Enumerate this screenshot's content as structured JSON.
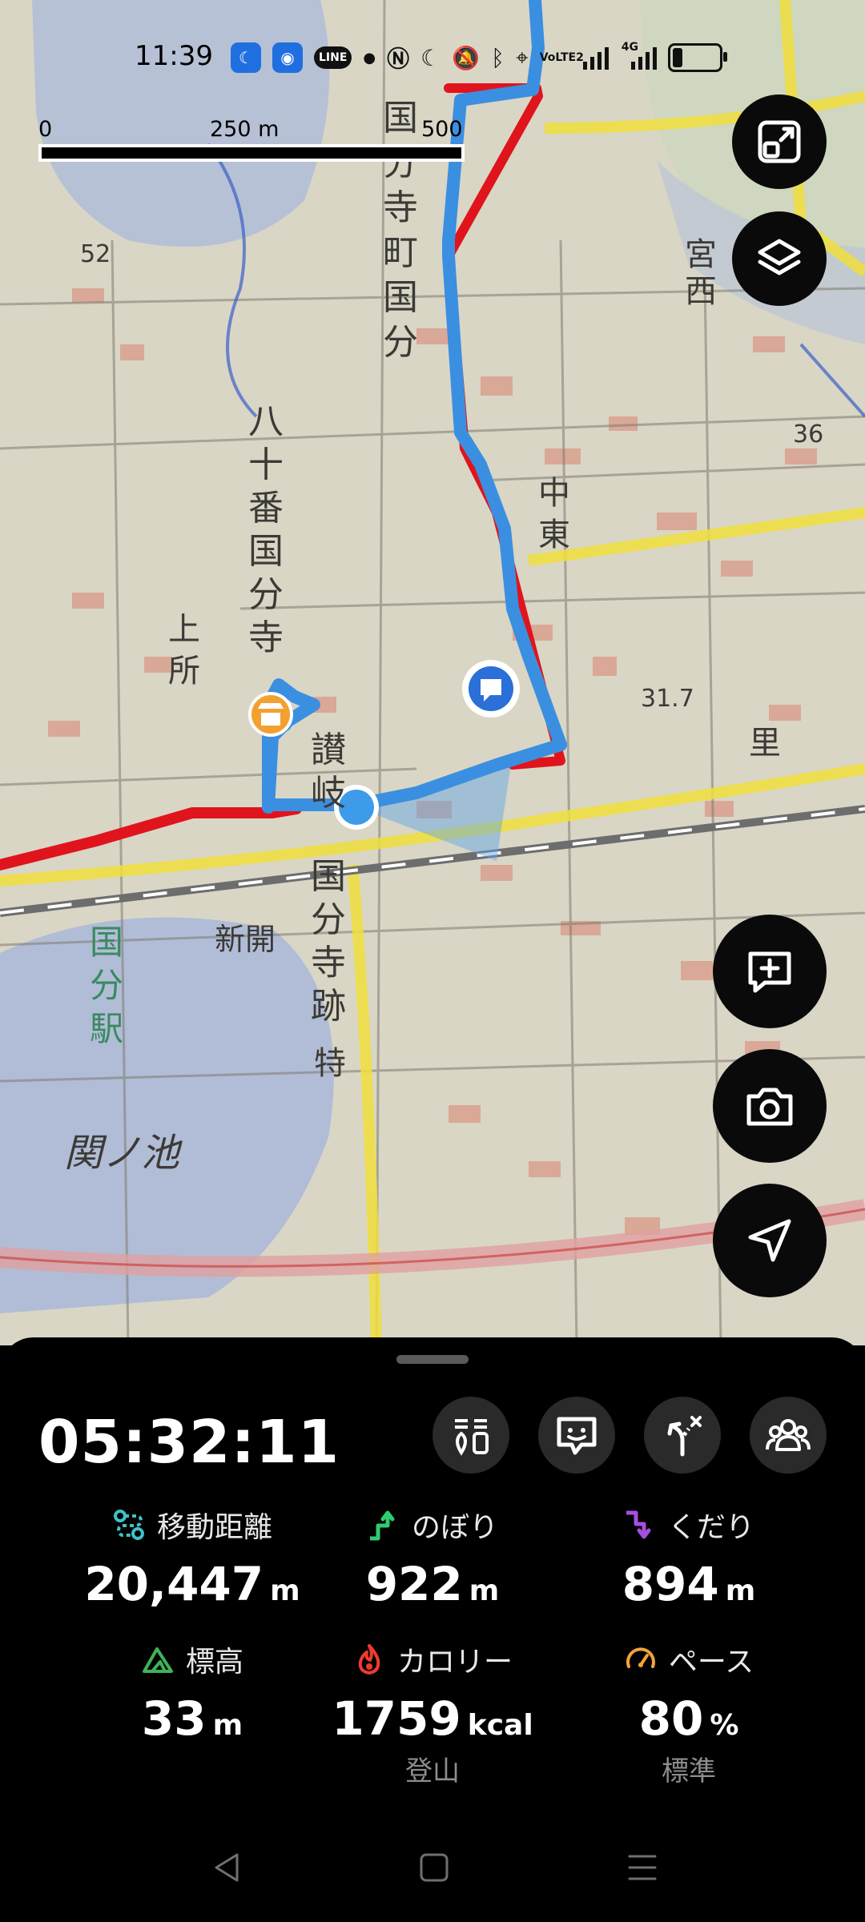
{
  "status_bar": {
    "time": "11:39",
    "icons": [
      "moon-badge-icon",
      "hotspot-badge-icon",
      "line-app-icon",
      "dot-icon",
      "nfc-icon",
      "do-not-disturb-icon",
      "mute-icon",
      "bluetooth-icon",
      "location-icon",
      "volte-icon",
      "signal-icon",
      "4g-signal-icon",
      "battery-icon"
    ],
    "line_label": "LINE",
    "volte_label": "VoLTE2",
    "net_label": "4G"
  },
  "map": {
    "scale_bar": {
      "label_0": "0",
      "label_250": "250 m",
      "label_500": "500 m"
    },
    "map_labels": [
      "国",
      "分",
      "寺",
      "町",
      "国",
      "分",
      "八",
      "十",
      "番",
      "国",
      "分",
      "寺",
      "讃",
      "岐",
      "国",
      "分",
      "寺",
      "跡",
      "中",
      "東",
      "上",
      "所",
      "新",
      "開",
      "国",
      "分",
      "駅",
      "関",
      "ノ",
      "池",
      "特",
      "里",
      "宮",
      "西"
    ],
    "elevation_labels": [
      "52",
      "36",
      "31.7"
    ],
    "route_color": "#3b8fe0",
    "planned_route_color": "#e0141c"
  },
  "buttons": {
    "map_fit": "fit-route-icon",
    "layers": "layers-icon",
    "add_note": "add-note-icon",
    "camera": "camera-icon",
    "navigate": "navigate-icon"
  },
  "panel": {
    "elapsed_time": "05:32:11",
    "action_icons": [
      "gear-check-icon",
      "chat-face-icon",
      "route-branch-icon",
      "group-icon"
    ],
    "stats": [
      {
        "label": "移動距離",
        "value": "20,447",
        "unit": "m",
        "icon": "distance-icon",
        "color": "#3fc1c9"
      },
      {
        "label": "のぼり",
        "value": "922",
        "unit": "m",
        "icon": "ascent-icon",
        "color": "#2ecc71"
      },
      {
        "label": "くだり",
        "value": "894",
        "unit": "m",
        "icon": "descent-icon",
        "color": "#a64ee0"
      },
      {
        "label": "標高",
        "value": "33",
        "unit": "m",
        "icon": "mountain-icon",
        "color": "#3cb35a"
      },
      {
        "label": "カロリー",
        "value": "1759",
        "unit": "kcal",
        "sub": "登山",
        "icon": "flame-icon",
        "color": "#ee3b2e"
      },
      {
        "label": "ペース",
        "value": "80",
        "unit": "%",
        "sub": "標準",
        "icon": "speedometer-icon",
        "color": "#f2a33a"
      }
    ]
  },
  "nav_bar": {
    "back": "back-icon",
    "home": "home-icon",
    "menu": "recents-icon"
  }
}
